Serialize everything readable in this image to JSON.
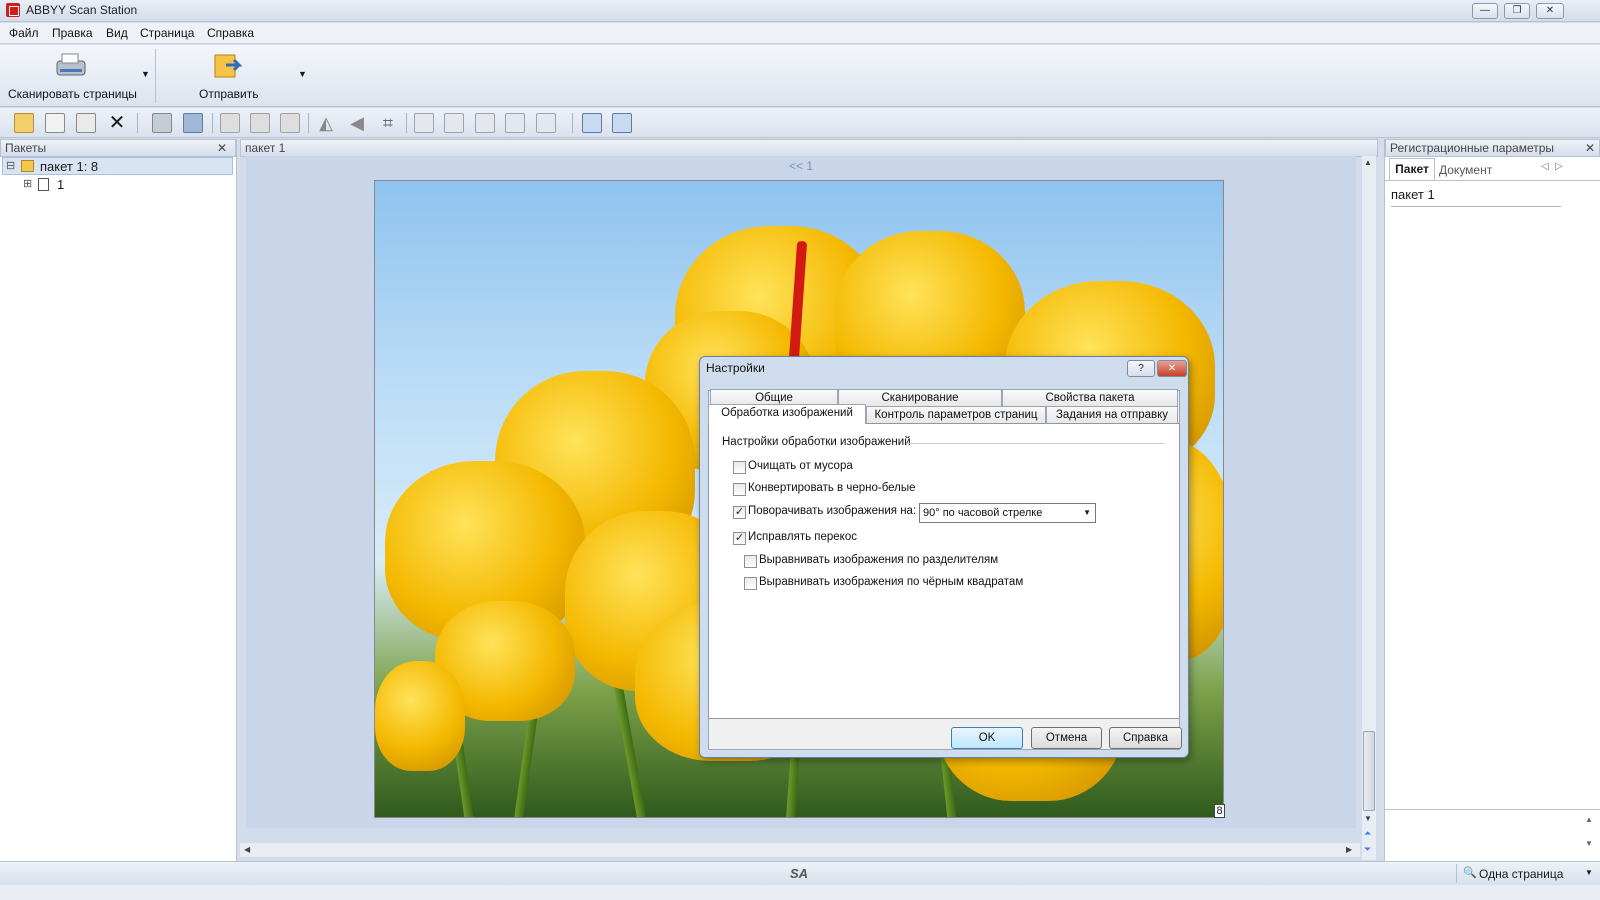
{
  "window": {
    "title": "ABBYY Scan Station",
    "min": "—",
    "max": "❐",
    "close": "✕"
  },
  "menu": [
    "Файл",
    "Правка",
    "Вид",
    "Страница",
    "Справка"
  ],
  "ribbon": {
    "scan_label": "Сканировать страницы",
    "send_label": "Отправить"
  },
  "left_pane": {
    "title": "Пакеты",
    "close": "✕",
    "batch_label": "пакет 1: 8",
    "doc_label": "1",
    "expand_minus": "⊟",
    "expand_plus": "⊞"
  },
  "center": {
    "tab_label": "пакет 1",
    "nav": "<< 1",
    "page_count": "8"
  },
  "right_pane": {
    "title": "Регистрационные параметры",
    "close": "✕",
    "tabs": [
      "Пакет",
      "Документ"
    ],
    "value": "пакет 1"
  },
  "status": {
    "center": "SA",
    "view_mode": "Одна страница"
  },
  "dialog": {
    "title": "Настройки",
    "help": "?",
    "close": "✕",
    "tabs_row1": [
      "Общие",
      "Сканирование",
      "Свойства пакета"
    ],
    "tabs_row2": [
      "Обработка изображений",
      "Контроль параметров страниц",
      "Задания на отправку"
    ],
    "group_title": "Настройки обработки изображений",
    "options": [
      {
        "label": "Очищать от мусора",
        "checked": false
      },
      {
        "label": "Конвертировать в черно-белые",
        "checked": false
      },
      {
        "label": "Поворачивать изображения на:",
        "checked": true
      },
      {
        "label": "Исправлять перекос",
        "checked": true
      },
      {
        "label": "Выравнивать изображения по разделителям",
        "checked": false
      },
      {
        "label": "Выравнивать изображения по чёрным квадратам",
        "checked": false
      }
    ],
    "rotate_value": "90° по часовой стрелке",
    "buttons": {
      "ok": "OK",
      "cancel": "Отмена",
      "help": "Справка"
    },
    "check_glyph": "✓"
  }
}
